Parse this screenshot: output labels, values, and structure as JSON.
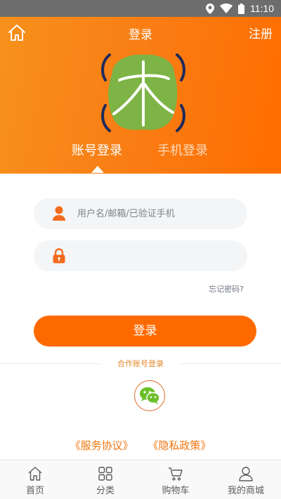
{
  "status_bar": {
    "time": "11:10",
    "icons": [
      "location-icon",
      "wifi-icon",
      "battery-icon"
    ]
  },
  "header": {
    "title": "登录",
    "register_label": "注册",
    "home_icon": "home-icon"
  },
  "tabs": [
    {
      "label": "账号登录",
      "active": true
    },
    {
      "label": "手机登录",
      "active": false
    }
  ],
  "form": {
    "username_placeholder": "用户名/邮箱/已验证手机",
    "username_value": "",
    "password_placeholder": "",
    "password_value": "",
    "forgot_label": "忘记密码?",
    "login_label": "登录"
  },
  "partner": {
    "label": "合作账号登录",
    "wechat_icon": "wechat-icon"
  },
  "agreements": {
    "service": "《服务协议》",
    "privacy": "《隐私政策》"
  },
  "bottom_nav": [
    {
      "label": "首页",
      "icon": "home-icon"
    },
    {
      "label": "分类",
      "icon": "grid-icon"
    },
    {
      "label": "购物车",
      "icon": "cart-icon"
    },
    {
      "label": "我的商城",
      "icon": "user-icon"
    }
  ],
  "colors": {
    "brand_orange": "#ff6a00",
    "header_gradient_start": "#f7911c",
    "logo_green": "#7db445",
    "logo_navy": "#1e2a5a"
  }
}
